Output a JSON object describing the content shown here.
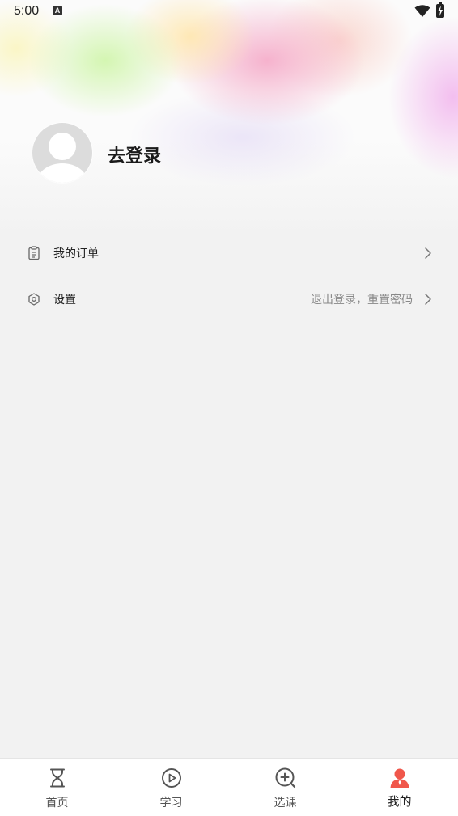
{
  "status_bar": {
    "time": "5:00",
    "notification_letter": "A"
  },
  "profile": {
    "login_label": "去登录"
  },
  "menu": {
    "orders": {
      "label": "我的订单",
      "icon": "clipboard-icon"
    },
    "settings": {
      "label": "设置",
      "hint": "退出登录，重置密码",
      "icon": "settings-hexagon-icon"
    }
  },
  "tabbar": {
    "active_color": "#f0574b",
    "tabs": [
      {
        "label": "首页",
        "icon": "hourglass-icon",
        "active": false
      },
      {
        "label": "学习",
        "icon": "play-circle-icon",
        "active": false
      },
      {
        "label": "选课",
        "icon": "plus-search-icon",
        "active": false
      },
      {
        "label": "我的",
        "icon": "user-icon",
        "active": true
      }
    ]
  }
}
